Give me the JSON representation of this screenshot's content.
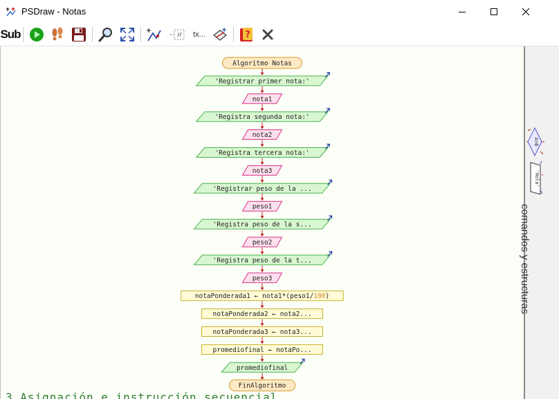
{
  "window": {
    "title": "PSDraw - Notas",
    "icon": "psdraw-app-icon"
  },
  "toolbar": {
    "sub_label": "Sub",
    "buttons": [
      {
        "name": "sub-button",
        "icon": "sub-text-icon"
      },
      {
        "name": "run-button",
        "icon": "play-icon",
        "color": "#1aa31a"
      },
      {
        "name": "step-button",
        "icon": "footsteps-icon",
        "color": "#c8743a"
      },
      {
        "name": "save-button",
        "icon": "floppy-disk-icon",
        "color": "#7a1a1a"
      },
      {
        "name": "zoom-button",
        "icon": "magnifier-icon"
      },
      {
        "name": "fit-button",
        "icon": "expand-arrows-icon"
      },
      {
        "name": "draw-button",
        "icon": "flowchart-draw-icon"
      },
      {
        "name": "comment-button",
        "icon": "comment-dashed-icon"
      },
      {
        "name": "text-button",
        "icon": "text-icon"
      },
      {
        "name": "style-button",
        "icon": "flowchart-style-icon"
      },
      {
        "name": "help-button",
        "icon": "help-icon",
        "color": "#d62020"
      },
      {
        "name": "close-button",
        "icon": "close-x-icon"
      }
    ],
    "text_button_label": "tx..."
  },
  "flowchart": {
    "start": "Algoritmo Notas",
    "end": "FinAlgoritmo",
    "steps": [
      {
        "type": "output",
        "text": "'Registrar primer nota:'"
      },
      {
        "type": "input",
        "text": "nota1"
      },
      {
        "type": "output",
        "text": "'Registra segunda nota:'"
      },
      {
        "type": "input",
        "text": "nota2"
      },
      {
        "type": "output",
        "text": "'Registra tercera nota:'"
      },
      {
        "type": "input",
        "text": "nota3"
      },
      {
        "type": "output",
        "text": "'Registrar peso de la ..."
      },
      {
        "type": "input",
        "text": "peso1"
      },
      {
        "type": "output",
        "text": "'Registra peso de la s..."
      },
      {
        "type": "input",
        "text": "peso2"
      },
      {
        "type": "output",
        "text": "'Registra peso de la t..."
      },
      {
        "type": "input",
        "text": "peso3"
      },
      {
        "type": "assign",
        "text": "notaPonderada1 ← nota1*(peso1/",
        "highlight": "100",
        "suffix": ")"
      },
      {
        "type": "assign",
        "text": "notaPonderada2 ← nota2..."
      },
      {
        "type": "assign",
        "text": "notaPonderada3 ← nota3..."
      },
      {
        "type": "assign",
        "text": "promediofinal ← notaPo..."
      },
      {
        "type": "output",
        "text": "promediofinal"
      }
    ]
  },
  "sidepanel": {
    "label": "comandos y estructuras",
    "mini_decision": "A>B",
    "mini_output": "'Hola'"
  },
  "bottom_text": "3 Asignación e instrucción secuencial",
  "colors": {
    "canvas_bg": "#fbfff7",
    "terminal_fill": "#ffe9c4",
    "terminal_stroke": "#d89a2c",
    "output_fill": "#d8f7d0",
    "output_stroke": "#4caf50",
    "input_fill": "#fde0ee",
    "input_stroke": "#d6318a",
    "assign_fill": "#fffbd6",
    "assign_stroke": "#c9b12a",
    "arrow": "#c02020",
    "number_highlight": "#d08a2c"
  }
}
